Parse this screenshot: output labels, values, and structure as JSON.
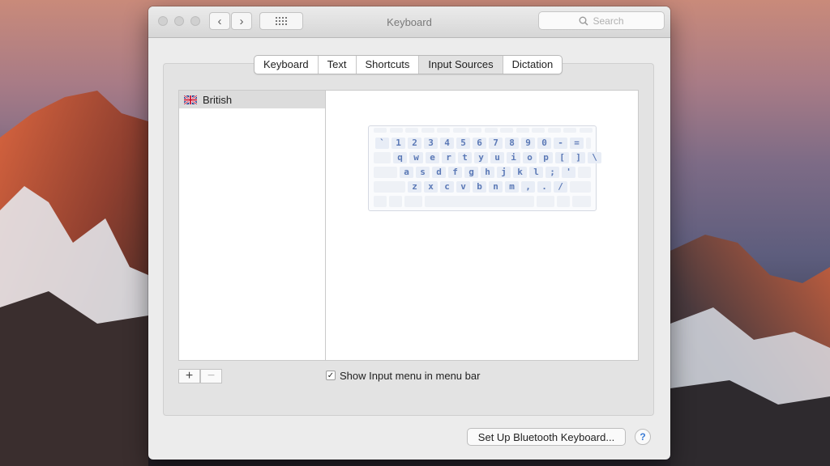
{
  "window": {
    "title": "Keyboard",
    "search_placeholder": "Search",
    "back_icon": "chevron-left-icon",
    "forward_icon": "chevron-right-icon",
    "grid_icon": "grid-icon"
  },
  "tabs": [
    {
      "label": "Keyboard",
      "active": false
    },
    {
      "label": "Text",
      "active": false
    },
    {
      "label": "Shortcuts",
      "active": false
    },
    {
      "label": "Input Sources",
      "active": true
    },
    {
      "label": "Dictation",
      "active": false
    }
  ],
  "input_sources": {
    "items": [
      {
        "label": "British",
        "flag": "uk-flag-icon"
      }
    ],
    "add_label": "+",
    "remove_label": "−"
  },
  "keyboard_layout": {
    "rows": [
      [
        "`",
        "1",
        "2",
        "3",
        "4",
        "5",
        "6",
        "7",
        "8",
        "9",
        "0",
        "-",
        "="
      ],
      [
        "q",
        "w",
        "e",
        "r",
        "t",
        "y",
        "u",
        "i",
        "o",
        "p",
        "[",
        "]",
        "\\"
      ],
      [
        "a",
        "s",
        "d",
        "f",
        "g",
        "h",
        "j",
        "k",
        "l",
        ";",
        "'"
      ],
      [
        "z",
        "x",
        "c",
        "v",
        "b",
        "n",
        "m",
        ",",
        ".",
        "/"
      ]
    ]
  },
  "show_input_menu": {
    "checked": true,
    "check_mark": "✓",
    "label": "Show Input menu in menu bar"
  },
  "footer": {
    "bluetooth_button": "Set Up Bluetooth Keyboard...",
    "help_label": "?"
  },
  "colors": {
    "key_text": "#5b79b6",
    "arrow": "#111111"
  }
}
